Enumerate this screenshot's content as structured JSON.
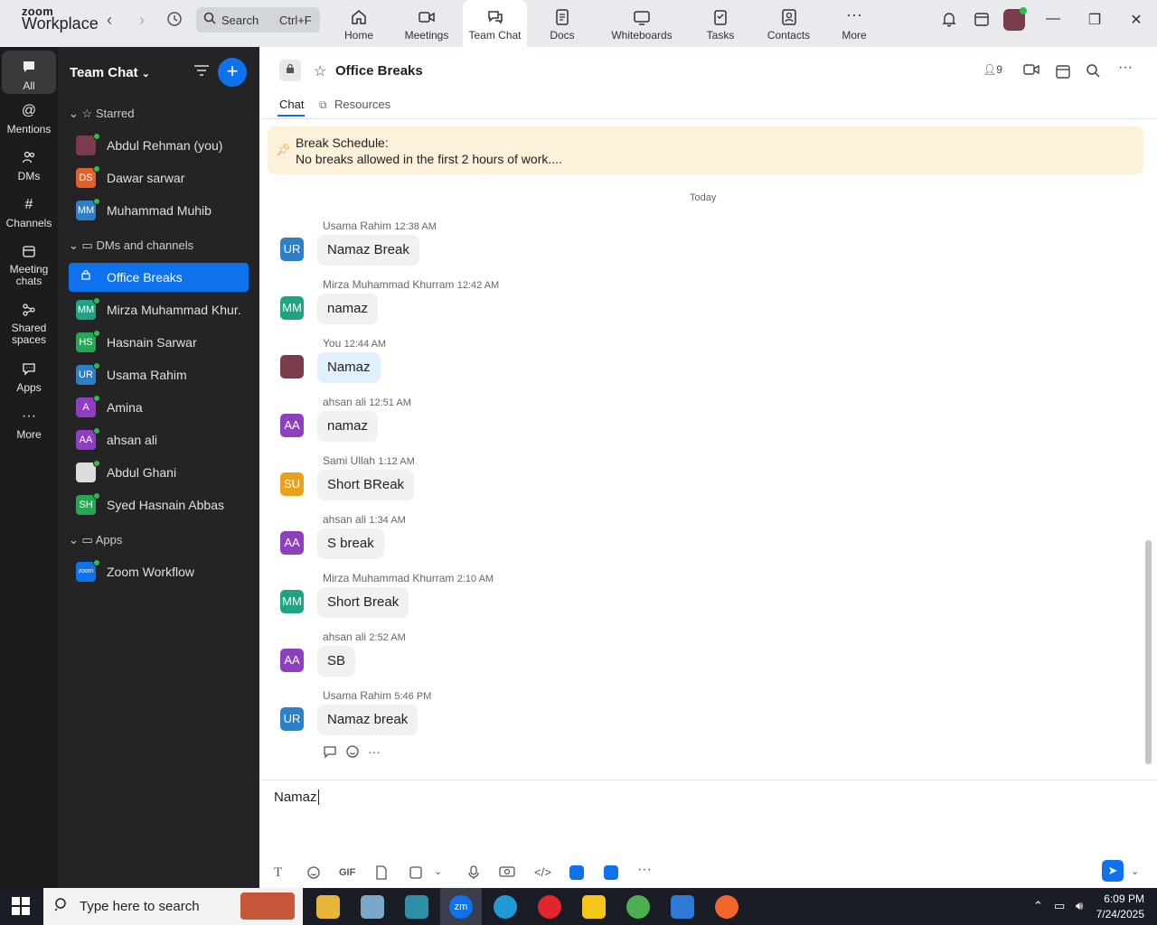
{
  "app": {
    "brand_top": "zoom",
    "brand_bottom": "Workplace"
  },
  "search": {
    "label": "Search",
    "shortcut": "Ctrl+F"
  },
  "nav_tabs": [
    {
      "label": "Home",
      "icon": "home-icon"
    },
    {
      "label": "Meetings",
      "icon": "video-icon"
    },
    {
      "label": "Team Chat",
      "icon": "chat-icon",
      "active": true
    },
    {
      "label": "Docs",
      "icon": "doc-icon"
    },
    {
      "label": "Whiteboards",
      "icon": "whiteboard-icon"
    },
    {
      "label": "Tasks",
      "icon": "tasks-icon"
    },
    {
      "label": "Contacts",
      "icon": "contacts-icon"
    },
    {
      "label": "More",
      "icon": "more-icon"
    }
  ],
  "rail": [
    {
      "label": "All",
      "icon": "chat-bubble-icon",
      "active": true
    },
    {
      "label": "Mentions",
      "icon": "at-icon"
    },
    {
      "label": "DMs",
      "icon": "people-icon"
    },
    {
      "label": "Channels",
      "icon": "hash-icon"
    },
    {
      "label": "Meeting chats",
      "icon": "calendar-icon"
    },
    {
      "label": "Shared spaces",
      "icon": "share-icon"
    },
    {
      "label": "Apps",
      "icon": "apps-icon"
    },
    {
      "label": "More",
      "icon": "more-icon"
    }
  ],
  "sidebar": {
    "title": "Team Chat",
    "sections": {
      "starred": "Starred",
      "dms": "DMs and channels",
      "apps": "Apps"
    },
    "starred": [
      {
        "name": "Abdul Rehman (you)",
        "initials": "",
        "color": "#7a3b4a",
        "photo": true
      },
      {
        "name": "Dawar sarwar",
        "initials": "DS",
        "color": "#e0612b"
      },
      {
        "name": "Muhammad Muhib",
        "initials": "MM",
        "color": "#2e7fc4"
      }
    ],
    "dms": [
      {
        "name": "Office Breaks",
        "initials": "",
        "color": "",
        "channel": true,
        "active": true
      },
      {
        "name": "Mirza Muhammad Khur...",
        "initials": "MM",
        "color": "#1fa383"
      },
      {
        "name": "Hasnain Sarwar",
        "initials": "HS",
        "color": "#27a653"
      },
      {
        "name": "Usama Rahim",
        "initials": "UR",
        "color": "#2e7fc4"
      },
      {
        "name": "Amina",
        "initials": "A",
        "color": "#8e3fbf"
      },
      {
        "name": "ahsan ali",
        "initials": "AA",
        "color": "#8e3fbf"
      },
      {
        "name": "Abdul Ghani",
        "initials": "",
        "color": "#ddd",
        "photo": true
      },
      {
        "name": "Syed Hasnain Abbas",
        "initials": "SH",
        "color": "#27a653"
      }
    ],
    "apps": [
      {
        "name": "Zoom Workflow",
        "initials": "zoom",
        "color": "#0e72ed"
      }
    ]
  },
  "chat": {
    "title": "Office Breaks",
    "member_count": "9",
    "tabs": {
      "chat": "Chat",
      "resources": "Resources"
    },
    "pinned_line1": "Break Schedule:",
    "pinned_line2": "No breaks allowed in the first 2 hours of work....",
    "day_divider": "Today",
    "messages": [
      {
        "sender": "Usama Rahim",
        "time": "12:38 AM",
        "text": "Namaz Break",
        "initials": "UR",
        "color": "#2e7fc4"
      },
      {
        "sender": "Mirza Muhammad Khurram",
        "time": "12:42 AM",
        "text": "namaz",
        "initials": "MM",
        "color": "#1fa383"
      },
      {
        "sender": "You",
        "time": "12:44 AM",
        "text": "Namaz",
        "initials": "",
        "color": "#7a3b4a",
        "mine": true
      },
      {
        "sender": "ahsan ali",
        "time": "12:51 AM",
        "text": "namaz",
        "initials": "AA",
        "color": "#8e3fbf"
      },
      {
        "sender": "Sami Ullah",
        "time": "1:12 AM",
        "text": "Short BReak",
        "initials": "SU",
        "color": "#e8a21b"
      },
      {
        "sender": "ahsan ali",
        "time": "1:34 AM",
        "text": "S break",
        "initials": "AA",
        "color": "#8e3fbf"
      },
      {
        "sender": "Mirza Muhammad Khurram",
        "time": "2:10 AM",
        "text": "Short Break",
        "initials": "MM",
        "color": "#1fa383"
      },
      {
        "sender": "ahsan ali",
        "time": "2:52 AM",
        "text": "SB",
        "initials": "AA",
        "color": "#8e3fbf"
      },
      {
        "sender": "Usama Rahim",
        "time": "5:46 PM",
        "text": "Namaz break",
        "initials": "UR",
        "color": "#2e7fc4"
      }
    ]
  },
  "composer": {
    "draft": "Namaz",
    "gif_label": "GIF"
  },
  "taskbar": {
    "search_placeholder": "Type here to search",
    "time": "6:09 PM",
    "date": "7/24/2025"
  }
}
